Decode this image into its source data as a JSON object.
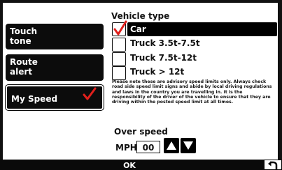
{
  "menu": {
    "items": [
      {
        "label": "Touch tone",
        "selected": false
      },
      {
        "label": "Route alert",
        "selected": false
      },
      {
        "label": "My Speed",
        "selected": true
      }
    ]
  },
  "vehicle_type": {
    "title": "Vehicle type",
    "options": [
      {
        "label": "Car",
        "checked": true
      },
      {
        "label": "Truck 3.5t-7.5t",
        "checked": false
      },
      {
        "label": "Truck 7.5t-12t",
        "checked": false
      },
      {
        "label": "Truck > 12t",
        "checked": false
      }
    ]
  },
  "notice": "Please note these are advisory speed limits only. Always check road side speed limit signs and abide by local driving regulations and laws in the country you are travelling in. It is the responsibility of the driver of the vehicle to ensure that they are driving within the posted speed limit at all times.",
  "over_speed": {
    "title": "Over speed",
    "unit_label": "MPH",
    "value": "00"
  },
  "bottom": {
    "ok_label": "OK"
  },
  "colors": {
    "check": "#e0201c",
    "background": "#ffffff",
    "dark": "#0c0c0c"
  },
  "icons": {
    "check": "check-icon",
    "up": "up-arrow-icon",
    "down": "down-arrow-icon",
    "back": "back-arrow-icon"
  }
}
